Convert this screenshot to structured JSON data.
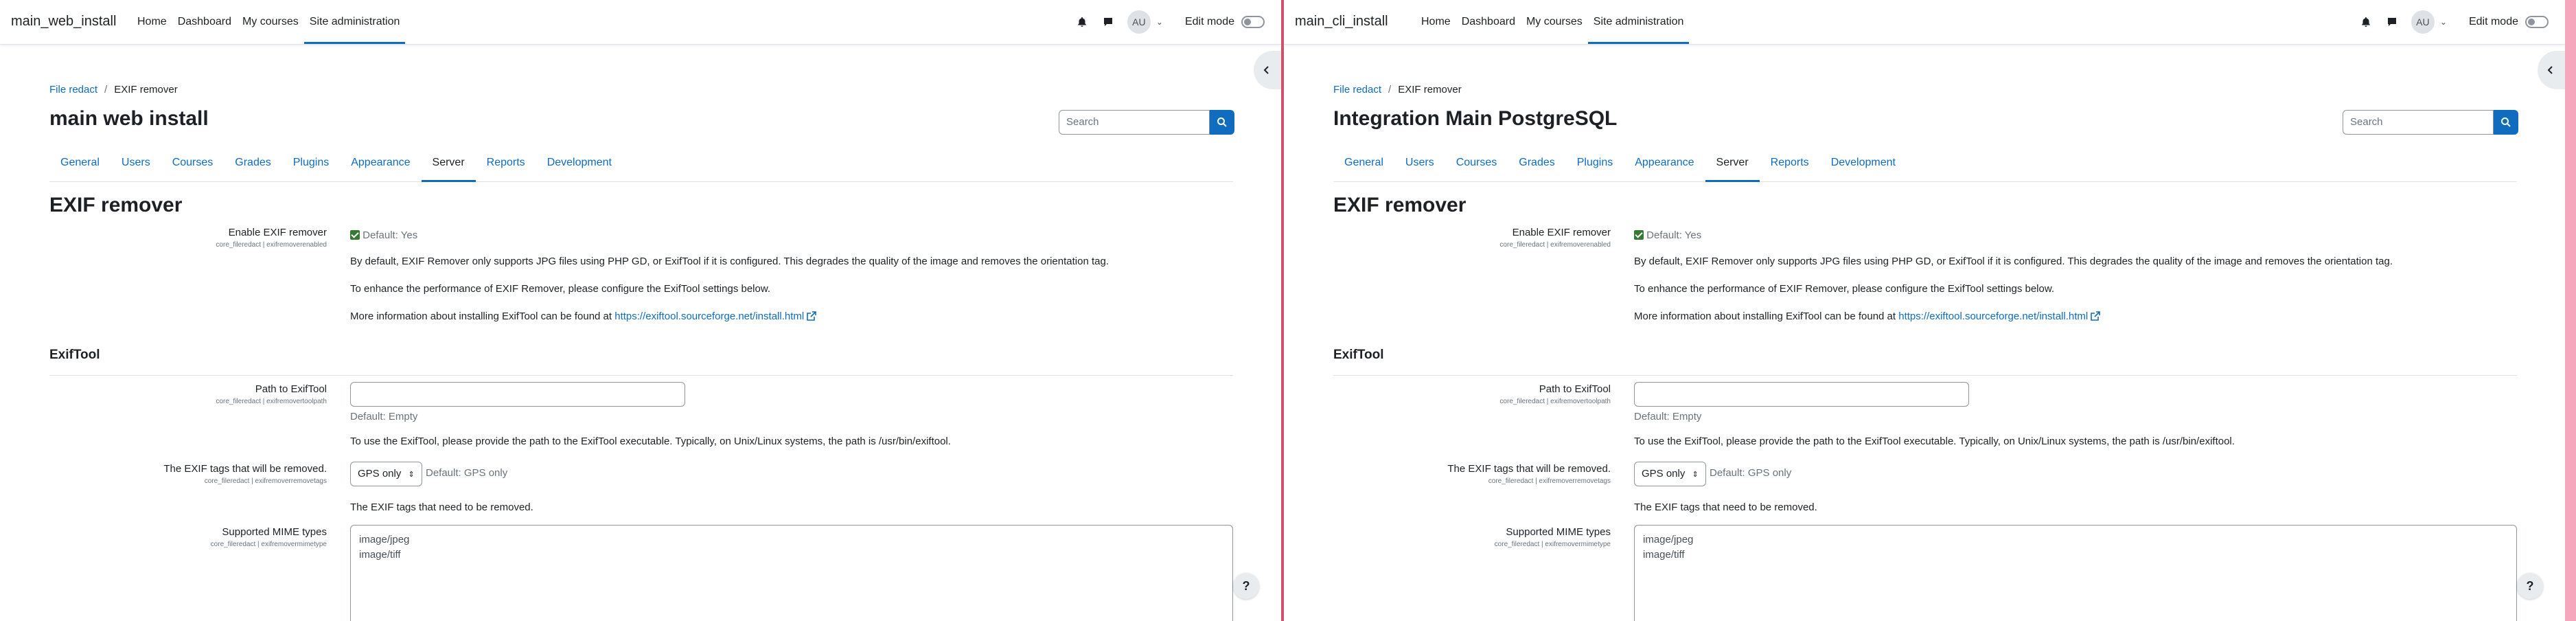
{
  "panes": [
    {
      "site_name": "main_web_install",
      "nav": [
        "Home",
        "Dashboard",
        "My courses",
        "Site administration"
      ],
      "avatar": "AU",
      "edit_mode_label": "Edit mode",
      "breadcrumb": [
        "File redact",
        "EXIF remover"
      ],
      "page_title": "main web install",
      "search_placeholder": "Search",
      "tabs": [
        "General",
        "Users",
        "Courses",
        "Grades",
        "Plugins",
        "Appearance",
        "Server",
        "Reports",
        "Development"
      ],
      "section_title": "EXIF remover",
      "enable": {
        "label": "Enable EXIF remover",
        "sub": "core_fileredact | exifremoverenabled",
        "default": "Default: Yes"
      },
      "desc1": "By default, EXIF Remover only supports JPG files using PHP GD, or ExifTool if it is configured. This degrades the quality of the image and removes the orientation tag.",
      "desc2": "To enhance the performance of EXIF Remover, please configure the ExifTool settings below.",
      "desc3_prefix": "More information about installing ExifTool can be found at",
      "desc3_link": "https://exiftool.sourceforge.net/install.html",
      "exiftool_heading": "ExifTool",
      "path": {
        "label": "Path to ExifTool",
        "sub": "core_fileredact | exifremovertoolpath",
        "default": "Default: Empty",
        "help": "To use the ExifTool, please provide the path to the ExifTool executable. Typically, on Unix/Linux systems, the path is /usr/bin/exiftool."
      },
      "tags": {
        "label": "The EXIF tags that will be removed.",
        "sub": "core_fileredact | exifremoverremovetags",
        "value": "GPS only",
        "default": "Default: GPS only",
        "help": "The EXIF tags that need to be removed."
      },
      "mime": {
        "label": "Supported MIME types",
        "sub": "core_fileredact | exifremovermimetype",
        "line1": "image/jpeg",
        "line2": "image/tiff"
      },
      "help_glyph": "?"
    },
    {
      "site_name": "main_cli_install",
      "nav": [
        "Home",
        "Dashboard",
        "My courses",
        "Site administration"
      ],
      "avatar": "AU",
      "edit_mode_label": "Edit mode",
      "breadcrumb": [
        "File redact",
        "EXIF remover"
      ],
      "page_title": "Integration Main PostgreSQL",
      "search_placeholder": "Search",
      "tabs": [
        "General",
        "Users",
        "Courses",
        "Grades",
        "Plugins",
        "Appearance",
        "Server",
        "Reports",
        "Development"
      ],
      "section_title": "EXIF remover",
      "enable": {
        "label": "Enable EXIF remover",
        "sub": "core_fileredact | exifremoverenabled",
        "default": "Default: Yes"
      },
      "desc1": "By default, EXIF Remover only supports JPG files using PHP GD, or ExifTool if it is configured. This degrades the quality of the image and removes the orientation tag.",
      "desc2": "To enhance the performance of EXIF Remover, please configure the ExifTool settings below.",
      "desc3_prefix": "More information about installing ExifTool can be found at",
      "desc3_link": "https://exiftool.sourceforge.net/install.html",
      "exiftool_heading": "ExifTool",
      "path": {
        "label": "Path to ExifTool",
        "sub": "core_fileredact | exifremovertoolpath",
        "default": "Default: Empty",
        "help": "To use the ExifTool, please provide the path to the ExifTool executable. Typically, on Unix/Linux systems, the path is /usr/bin/exiftool."
      },
      "tags": {
        "label": "The EXIF tags that will be removed.",
        "sub": "core_fileredact | exifremoverremovetags",
        "value": "GPS only",
        "default": "Default: GPS only",
        "help": "The EXIF tags that need to be removed."
      },
      "mime": {
        "label": "Supported MIME types",
        "sub": "core_fileredact | exifremovermimetype",
        "line1": "image/jpeg",
        "line2": "image/tiff"
      },
      "help_glyph": "?"
    }
  ],
  "icons": {
    "bell": "bell-icon",
    "messages": "chat-icon",
    "search": "search-icon",
    "drawer": "chevron-left-icon",
    "external": "external-link-icon"
  },
  "colors": {
    "link": "#0f6cbf",
    "primary": "#0f6cbf",
    "success": "#357a32",
    "splitter": "#d0506b"
  }
}
